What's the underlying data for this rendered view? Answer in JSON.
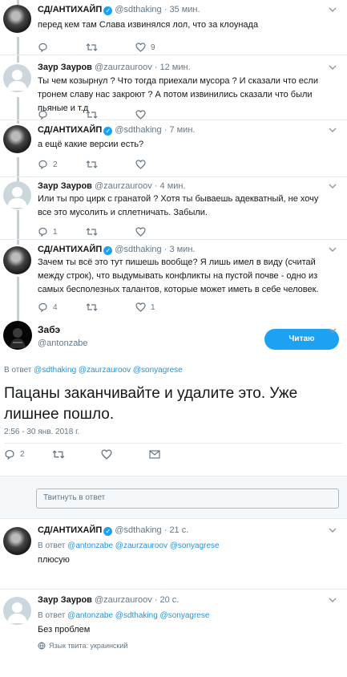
{
  "tweets": [
    {
      "name": "СД/АНТИХАЙП",
      "handle": "@sdthaking",
      "time": "35 мин.",
      "text": "перед кем там Слава извинялся лол, что за клоунада",
      "replies": "",
      "retweets": "",
      "likes": "9"
    },
    {
      "name": "Заур Зауров",
      "handle": "@zaurzauroov",
      "time": "12 мин.",
      "text": "Ты чем козырнул ? Что тогда приехали мусора ? И сказали что если тронем славу нас закроют ? А потом извинились сказали что были пьяные и т.д",
      "replies": "",
      "retweets": "",
      "likes": ""
    },
    {
      "name": "СД/АНТИХАЙП",
      "handle": "@sdthaking",
      "time": "7 мин.",
      "text": "а ещё какие версии есть?",
      "replies": "2",
      "retweets": "",
      "likes": ""
    },
    {
      "name": "Заур Зауров",
      "handle": "@zaurzauroov",
      "time": "4 мин.",
      "text": "Или ты про цирк с гранатой ? Хотя ты бываешь адекватный, не хочу все это мусолить и сплетничать. Забыли.",
      "replies": "1",
      "retweets": "",
      "likes": ""
    },
    {
      "name": "СД/АНТИХАЙП",
      "handle": "@sdthaking",
      "time": "3 мин.",
      "text": "Зачем ты всё это тут пишешь вообще? Я лишь имел в виду (считай между строк), что выдумывать конфликты на пустой почве - одно из самых бесполезных талантов, которые может иметь в себе человек.",
      "replies": "4",
      "retweets": "",
      "likes": "1"
    }
  ],
  "main": {
    "name": "Забэ",
    "handle": "@antonzabe",
    "follow_label": "Читаю",
    "reply_prefix": "В ответ",
    "reply_to": "@sdthaking @zaurzauroov @sonyagrese",
    "text": "Пацаны заканчивайте и удалите это. Уже лишнее пошло.",
    "timestamp": "2:56 - 30 янв. 2018 г.",
    "replies": "2",
    "retweets": "",
    "likes": ""
  },
  "reply_box": {
    "placeholder": "Твитнуть в ответ"
  },
  "replies_below": [
    {
      "name": "СД/АНТИХАЙП",
      "handle": "@sdthaking",
      "time": "21 с.",
      "reply_prefix": "В ответ",
      "reply_to": "@antonzabe @zaurzauroov @sonyagrese",
      "text": "плюсую"
    },
    {
      "name": "Заур Зауров",
      "handle": "@zaurzauroov",
      "time": "20 с.",
      "reply_prefix": "В ответ",
      "reply_to": "@antonzabe @sdthaking @sonyagrese",
      "text": "Без проблем",
      "language": "Язык твита: украинский"
    }
  ],
  "colors": {
    "accent": "#1da1f2",
    "link": "#1b95e0",
    "muted": "#657786",
    "thread_line": "#c4cfd6"
  }
}
